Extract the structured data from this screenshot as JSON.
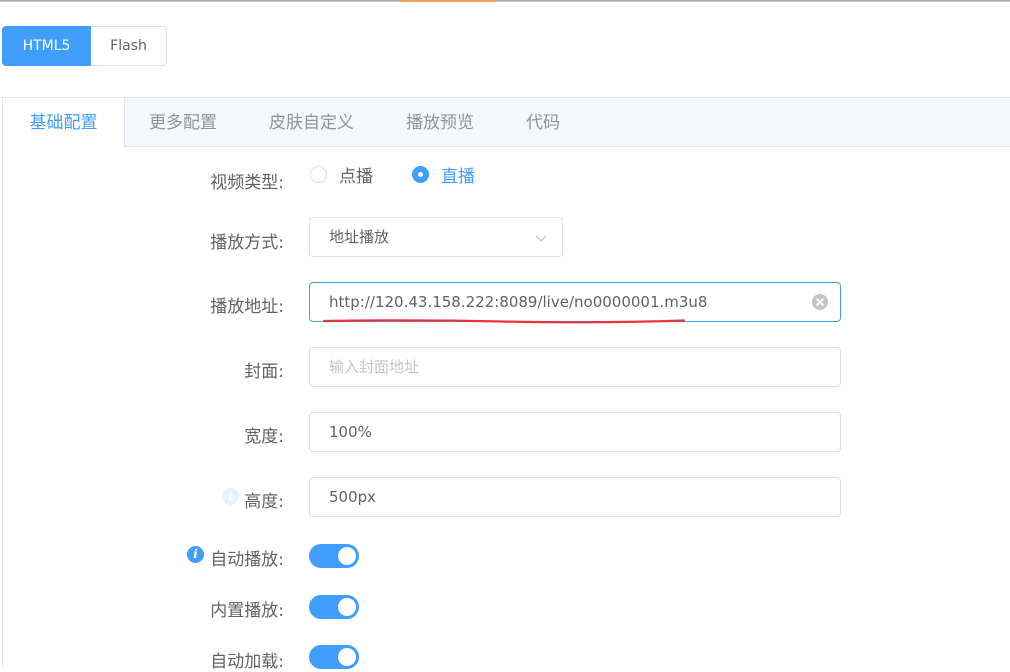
{
  "mode_switch": {
    "html5": "HTML5",
    "flash": "Flash",
    "active": "HTML5"
  },
  "tabs": [
    {
      "label": "基础配置",
      "active": true
    },
    {
      "label": "更多配置",
      "active": false
    },
    {
      "label": "皮肤自定义",
      "active": false
    },
    {
      "label": "播放预览",
      "active": false
    },
    {
      "label": "代码",
      "active": false
    }
  ],
  "form": {
    "video_type": {
      "label": "视频类型:",
      "options": [
        "点播",
        "直播"
      ],
      "selected": "直播"
    },
    "play_mode": {
      "label": "播放方式:",
      "value": "地址播放"
    },
    "play_url": {
      "label": "播放地址:",
      "value": "http://120.43.158.222:8089/live/no0000001.m3u8"
    },
    "cover": {
      "label": "封面:",
      "value": "",
      "placeholder": "输入封面地址"
    },
    "width": {
      "label": "宽度:",
      "value": "100%"
    },
    "height": {
      "label": "高度:",
      "value": "500px"
    },
    "autoplay": {
      "label": "自动播放:",
      "on": true
    },
    "inline_play": {
      "label": "内置播放:",
      "on": true
    },
    "autoload": {
      "label": "自动加载:",
      "on": true
    }
  },
  "colors": {
    "primary": "#409eff",
    "annotation_underline": "#e8323c",
    "top_accent": "#f0a35a"
  }
}
